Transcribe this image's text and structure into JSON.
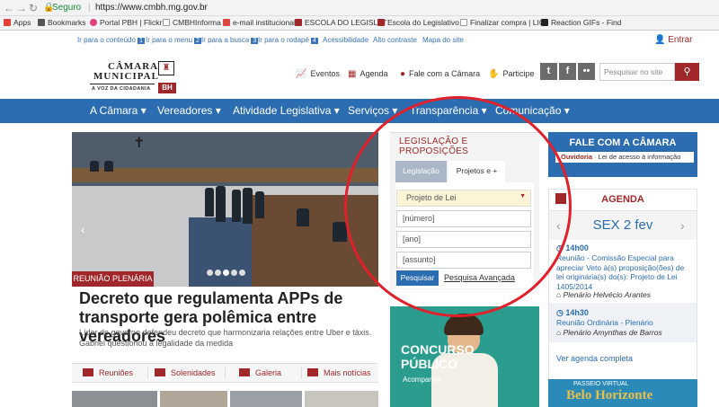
{
  "browser": {
    "secure_label": "Seguro",
    "url": "https://www.cmbh.mg.gov.br"
  },
  "bookmarks": [
    "Apps",
    "Bookmarks",
    "Portal PBH | Flickr",
    "CMBHInforma",
    "e-mail institucional",
    "ESCOLA DO LEGISLAT",
    "Escola do Legislativo",
    "Finalizar compra | LIC",
    "Reaction GIFs - Find"
  ],
  "access": {
    "items": [
      {
        "label": "Ir para o conteúdo",
        "num": "1"
      },
      {
        "label": "Ir para o menu",
        "num": "2"
      },
      {
        "label": "Ir para a busca",
        "num": "3"
      },
      {
        "label": "Ir para o rodapé",
        "num": "4"
      }
    ],
    "acessibilidade": "Acessibilidade",
    "alto_contraste": "Alto contraste",
    "mapa": "Mapa do site",
    "entrar": "Entrar"
  },
  "header": {
    "logo_line1": "CÂMARA",
    "logo_line2": "MUNICIPAL",
    "logo_tagline": "A VOZ DA CIDADANIA",
    "logo_bh": "BH",
    "links": [
      "Eventos",
      "Agenda",
      "Fale com a Câmara",
      "Participe"
    ],
    "search_placeholder": "Pesquisar no site"
  },
  "nav": [
    "A Câmara ▾",
    "Vereadores ▾",
    "Atividade Legislativa ▾",
    "Serviços ▾",
    "Transparência ▾",
    "Comunicação ▾"
  ],
  "hero": {
    "badge": "REUNIÃO PLENÁRIA",
    "headline": "Decreto que regulamenta APPs de transporte gera polêmica entre vereadores",
    "summary": "Líder de governo defendeu decreto que harmonizaria relações entre Uber e táxis. Gabriel questionou a legalidade da medida",
    "sublinks": [
      "Reuniões",
      "Solenidades",
      "Galeria",
      "Mais notícias"
    ]
  },
  "legislacao": {
    "title": "LEGISLAÇÃO E PROPOSIÇÕES",
    "tab1": "Legislação",
    "tab2": "Projetos e +",
    "select_value": "Projeto de Lei",
    "placeholders": [
      "[número]",
      "[ano]",
      "[assunto]"
    ],
    "search_button": "Pesquisar",
    "advanced": "Pesquisa Avançada"
  },
  "concurso": {
    "title1": "CONCURSO",
    "title2": "PÚBLICO",
    "sub": "Acompanhe"
  },
  "fale": {
    "title": "FALE COM A CÂMARA",
    "ouvidoria": "Ouvidoria",
    "lei": " · Lei de acesso à informação"
  },
  "agenda": {
    "title": "AGENDA",
    "day": "SEX 2 fev",
    "events": [
      {
        "time": "14h00",
        "desc": "Reunião - Comissão Especial para apreciar Veto à(s) proposição(ões) de lei originária(s) do(s): Projeto de Lei 1405/2014",
        "place": "Plenário Helvécio Arantes"
      },
      {
        "time": "14h30",
        "desc": "Reunião Ordinária - Plenário",
        "place": "Plenário Amynthas de Barros"
      }
    ],
    "more": "Ver agenda completa"
  },
  "passeio": {
    "label": "PASSEIO VIRTUAL",
    "name": "Belo Horizonte"
  },
  "colors": {
    "brand_red": "#a0282a",
    "nav_blue": "#2c6cb0",
    "annotation_red": "#e0202a"
  }
}
